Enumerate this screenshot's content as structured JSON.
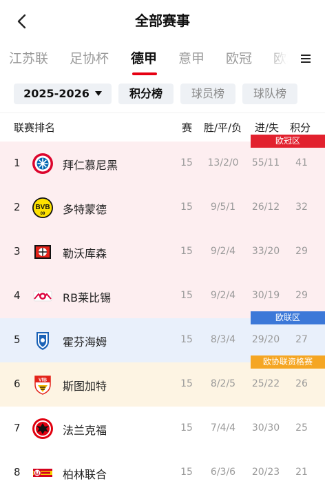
{
  "header": {
    "title": "全部赛事"
  },
  "tabs": [
    {
      "label": "江苏联",
      "active": false
    },
    {
      "label": "足协杯",
      "active": false
    },
    {
      "label": "德甲",
      "active": true
    },
    {
      "label": "意甲",
      "active": false
    },
    {
      "label": "欧冠",
      "active": false
    },
    {
      "label": "欧联",
      "active": false
    }
  ],
  "filters": {
    "season": "2025-2026",
    "points_table": "积分榜",
    "player_table": "球员榜",
    "team_table": "球队榜"
  },
  "table_header": {
    "rank": "联赛排名",
    "played": "赛",
    "wdl": "胜/平/负",
    "gd": "进/失",
    "points": "积分"
  },
  "zones": {
    "ucl": "欧冠区",
    "uel": "欧联区",
    "uecl": "欧协联资格赛"
  },
  "colors": {
    "accent": "#e60012",
    "ucl_bg": "#fdeef0",
    "uel_bg": "#e9f0fb",
    "uecl_bg": "#fdf4e3",
    "ucl_tag": "#e2212e",
    "uel_tag": "#3c78d8",
    "uecl_tag": "#f5a623"
  },
  "rows": [
    {
      "rank": "1",
      "team": "拜仁慕尼黑",
      "logo": "bayern-munich-logo",
      "played": "15",
      "wdl": "13/2/0",
      "gd": "55/11",
      "points": "41"
    },
    {
      "rank": "2",
      "team": "多特蒙德",
      "logo": "borussia-dortmund-logo",
      "played": "15",
      "wdl": "9/5/1",
      "gd": "26/12",
      "points": "32"
    },
    {
      "rank": "3",
      "team": "勒沃库森",
      "logo": "bayer-leverkusen-logo",
      "played": "15",
      "wdl": "9/2/4",
      "gd": "33/20",
      "points": "29"
    },
    {
      "rank": "4",
      "team": "RB莱比锡",
      "logo": "rb-leipzig-logo",
      "played": "15",
      "wdl": "9/2/4",
      "gd": "30/19",
      "points": "29"
    },
    {
      "rank": "5",
      "team": "霍芬海姆",
      "logo": "hoffenheim-logo",
      "played": "15",
      "wdl": "8/3/4",
      "gd": "29/20",
      "points": "27"
    },
    {
      "rank": "6",
      "team": "斯图加特",
      "logo": "vfb-stuttgart-logo",
      "played": "15",
      "wdl": "8/2/5",
      "gd": "25/22",
      "points": "26"
    },
    {
      "rank": "7",
      "team": "法兰克福",
      "logo": "eintracht-frankfurt-logo",
      "played": "15",
      "wdl": "7/4/4",
      "gd": "30/30",
      "points": "25"
    },
    {
      "rank": "8",
      "team": "柏林联合",
      "logo": "union-berlin-logo",
      "played": "15",
      "wdl": "6/3/6",
      "gd": "20/23",
      "points": "21"
    }
  ]
}
